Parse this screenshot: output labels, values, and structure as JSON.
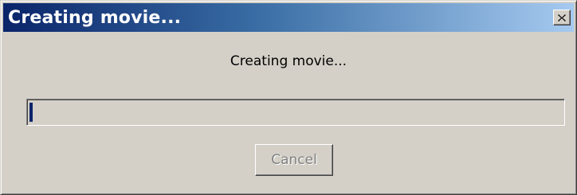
{
  "window": {
    "title": "Creating movie...",
    "close_icon": "close-x-icon"
  },
  "message": "Creating movie...",
  "progress": {
    "fraction": 0.005
  },
  "cancel_button": {
    "label": "Cancel",
    "enabled": false
  },
  "colors": {
    "title_gradient_start": "#0a246a",
    "title_gradient_end": "#a6caf0",
    "dialog_bg": "#d4d0c8",
    "progress_fill": "#0a246a"
  }
}
